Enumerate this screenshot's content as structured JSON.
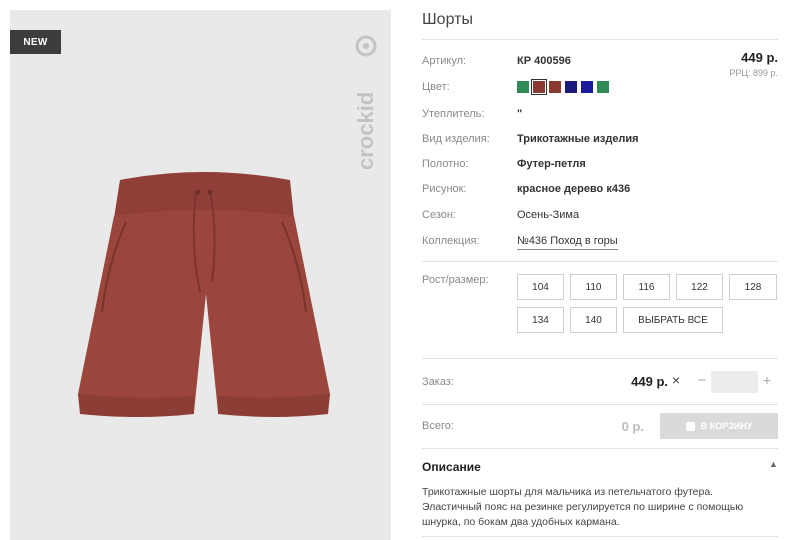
{
  "product": {
    "badge": "NEW",
    "brand": "crockid",
    "title": "Шорты"
  },
  "details": {
    "article_label": "Артикул:",
    "article_value": "КР 400596",
    "color_label": "Цвет:",
    "insulation_label": "Утеплитель:",
    "insulation_value": "\"",
    "type_label": "Вид изделия:",
    "type_value": "Трикотажные изделия",
    "fabric_label": "Полотно:",
    "fabric_value": "Футер-петля",
    "pattern_label": "Рисунок:",
    "pattern_value": "красное дерево к436",
    "season_label": "Сезон:",
    "season_value": "Осень-Зима",
    "collection_label": "Коллекция:",
    "collection_value": "№436 Поход в горы"
  },
  "price": {
    "value": "449 р.",
    "rrp": "РРЦ: 899 р."
  },
  "colors": [
    {
      "hex": "#2e8b57",
      "selected": false
    },
    {
      "hex": "#8b3a2f",
      "selected": true
    },
    {
      "hex": "#8b3a2f",
      "selected": false
    },
    {
      "hex": "#1a1a7a",
      "selected": false
    },
    {
      "hex": "#1a1a9a",
      "selected": false
    },
    {
      "hex": "#2e8b57",
      "selected": false
    }
  ],
  "sizes": {
    "label": "Рост/размер:",
    "items": [
      "104",
      "110",
      "116",
      "122",
      "128",
      "134",
      "140"
    ],
    "select_all": "ВЫБРАТЬ ВСЕ"
  },
  "order": {
    "label": "Заказ:",
    "price": "449 р.",
    "times": "×",
    "minus": "−",
    "plus": "+",
    "qty": ""
  },
  "total": {
    "label": "Всего:",
    "value": "0 р.",
    "cart_button": "В КОРЗИНУ"
  },
  "description": {
    "title": "Описание",
    "toggle": "▲",
    "text": "Трикотажные шорты для мальчика из петельчатого футера. Эластичный пояс на резинке регулируется по ширине с помощью шнурка, по бокам два удобных кармана."
  }
}
